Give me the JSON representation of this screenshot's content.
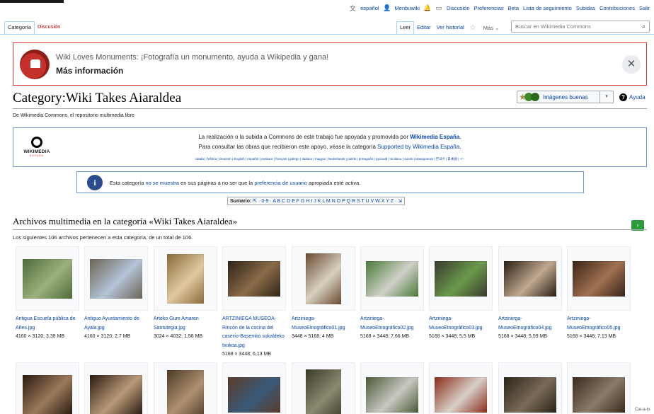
{
  "userbar": {
    "language": "español",
    "username": "Menbuwiki",
    "links": [
      "Discusión",
      "Preferencias",
      "Beta",
      "Lista de seguimiento",
      "Subidas",
      "Contribuciones",
      "Salir"
    ]
  },
  "tabs": {
    "category": "Categoría",
    "discussion": "Discusión",
    "read": "Leer",
    "edit": "Editar",
    "history": "Ver historial",
    "more": "Más"
  },
  "search": {
    "placeholder": "Buscar en Wikimedia Commons"
  },
  "banner": {
    "text": "Wiki Loves Monuments: ¡Fotografía un monumento, ayuda a Wikipedia y gana!",
    "more": "Más información"
  },
  "page": {
    "title": "Category:Wiki Takes Aiaraldea",
    "tagline": "De Wikimedia Commons, el repositorio multimedia libre",
    "good_images": "Imágenes buenas",
    "help": "Ayuda"
  },
  "wmes": {
    "logo_name": "WIKIMEDIA",
    "logo_sub": "ESPAÑA",
    "line1_pre": "La realización o la subida a Commons de este trabajo fue apoyada y promovida por ",
    "line1_link": "Wikimedia España",
    "line1_post": ".",
    "line2_pre": "Para consultar las obras que recibieron este apoyo, véase la categoría ",
    "line2_link": "Supported by Wikimedia España",
    "line2_post": ".",
    "languages": "català | čeština | Deutsch | English | español | euskara | français | galego | italiano | magyar | Nederlands | polski | português | русский | sicilianu | suomi | македонски | 한국어 | 日本語 | +/−"
  },
  "notice": {
    "pre": "Esta categoría ",
    "link1": "no se muestra",
    "mid": " en sus páginas a no ser que la ",
    "link2": "preferencia de usuario",
    "post": " apropiada esté activa."
  },
  "summary": {
    "label": "Sumario:",
    "items": "⇱ · 0-9 · A B C D E F G H I J K L M N O P Q R S T U V W X Y Z · ⇲"
  },
  "section": {
    "title": "Archivos multimedia en la categoría «Wiki Takes Aiaraldea»",
    "count": "Los siguientes 106 archivos pertenecen a esta categoría, de un total de 106."
  },
  "gallery": [
    {
      "name": "Antigua Escuela pública de Añes.jpg",
      "meta": "4160 × 3120; 3,38 MB",
      "c1": "#4f6a3a",
      "c2": "#9bb07a"
    },
    {
      "name": "Antiguo Ayuntamiento de Ayala.jpg",
      "meta": "4160 × 3120; 2,7 MB",
      "c1": "#6b6356",
      "c2": "#b5c4d8"
    },
    {
      "name": "Arteko Gure Amaren Santutegia.jpg",
      "meta": "3024 × 4032; 1,56 MB",
      "c1": "#8a6a3a",
      "c2": "#e0c9a0"
    },
    {
      "name": "ARTZINIEGA MUSEOA-Rincón de la cocina del caserío-Basemko sukaldeko txokoa.jpg",
      "meta": "5168 × 3448; 6,13 MB",
      "c1": "#2e2418",
      "c2": "#8a6a48"
    },
    {
      "name": "Artziniega-MuseoEtnográfico01.jpg",
      "meta": "3448 × 5168; 4 MB",
      "c1": "#6a4a30",
      "c2": "#d8d0c0"
    },
    {
      "name": "Artziniega-MuseoEtnográfico02.jpg",
      "meta": "5168 × 3448; 7,66 MB",
      "c1": "#4a7a3a",
      "c2": "#d0d0c8"
    },
    {
      "name": "Artziniega-MuseoEtnográfico03.jpg",
      "meta": "5168 × 3448; 5,5 MB",
      "c1": "#3a3a30",
      "c2": "#6a9a4a"
    },
    {
      "name": "Artziniega-MuseoEtnográfico04.jpg",
      "meta": "5168 × 3448; 5,59 MB",
      "c1": "#2a1e14",
      "c2": "#c0a890"
    },
    {
      "name": "Artziniega-MuseoEtnográfico05.jpg",
      "meta": "5168 × 3448; 7,13 MB",
      "c1": "#3a2418",
      "c2": "#a07050"
    },
    {
      "name": "",
      "meta": "",
      "c1": "#2a1a10",
      "c2": "#9a7a5a"
    },
    {
      "name": "",
      "meta": "",
      "c1": "#2a1a10",
      "c2": "#b89a78"
    },
    {
      "name": "",
      "meta": "",
      "c1": "#4a3a28",
      "c2": "#b09070"
    },
    {
      "name": "",
      "meta": "",
      "c1": "#5a3a28",
      "c2": "#3a5a7a"
    },
    {
      "name": "",
      "meta": "",
      "c1": "#3a3a28",
      "c2": "#8a8a70"
    },
    {
      "name": "",
      "meta": "",
      "c1": "#4a5a38",
      "c2": "#c8c8c0"
    },
    {
      "name": "",
      "meta": "",
      "c1": "#8a2a1a",
      "c2": "#d8d0c8"
    },
    {
      "name": "",
      "meta": "",
      "c1": "#2a2418",
      "c2": "#7a6a58"
    },
    {
      "name": "",
      "meta": "",
      "c1": "#3a2a1e",
      "c2": "#8a7a68"
    }
  ],
  "catlinks": "Cat-a-lo"
}
